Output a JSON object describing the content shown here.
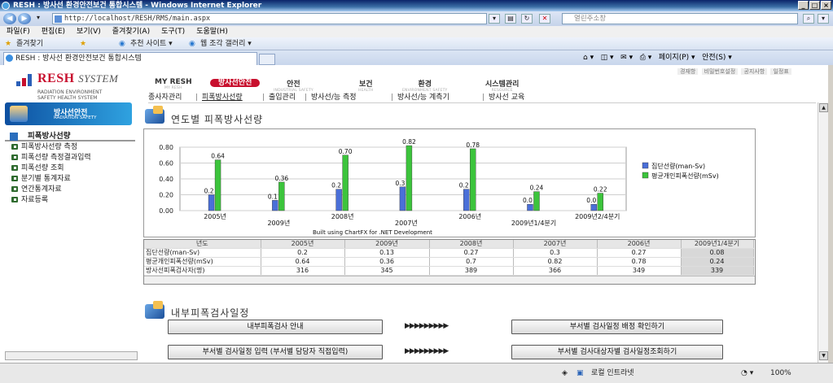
{
  "window": {
    "title": "RESH : 방사선 환경안전보건 통합시스템 - Windows Internet Explorer"
  },
  "browser": {
    "address": "http://localhost/RESH/RMS/main.aspx",
    "search_placeholder": "열린주소창",
    "menu": [
      "파일(F)",
      "편집(E)",
      "보기(V)",
      "즐겨찾기(A)",
      "도구(T)",
      "도움말(H)"
    ],
    "favorites_label": "즐겨찾기",
    "fav_suggest": "추천 사이트 ▾",
    "fav_gallery": "웹 조각 갤러리 ▾",
    "tab_title": "RESH : 방사선 환경안전보건 통합시스템",
    "page_menu": "페이지(P) ▾",
    "safety_menu": "안전(S) ▾"
  },
  "logo": {
    "brand": "RESH",
    "system": "SYSTEM",
    "sub1": "RADIATION ENVIRONMENT",
    "sub2": "SAFETY HEALTH SYSTEM"
  },
  "side_banner": {
    "title": "방사선안전",
    "sub": "RADIATION SAFETY"
  },
  "sidebar": {
    "heading": "피폭방사선량",
    "items": [
      "피폭방사선량 측정",
      "피폭선량 측정결과입력",
      "피폭선량 조회",
      "분기별 통계자료",
      "연간통계자료",
      "자료등록"
    ]
  },
  "util_links": [
    "경재항",
    "비밀번호설정",
    "공지사항",
    "일정표"
  ],
  "gnav": [
    {
      "label": "MY RESH",
      "sub": "MY RESH"
    },
    {
      "label": "방사선안전",
      "sub": ""
    },
    {
      "label": "안전",
      "sub": "INDUSTRIAL SAFETY"
    },
    {
      "label": "보건",
      "sub": "HEALTH"
    },
    {
      "label": "환경",
      "sub": "ENVIRONMENT SAFETY"
    },
    {
      "label": "시스템관리",
      "sub": "RESOURCE"
    }
  ],
  "subnav": [
    "종사자관리",
    "피폭방사선량",
    "출입관리",
    "방사선/능 측정",
    "방사선/능 계측기",
    "방사선 교육"
  ],
  "section1_title": "연도별 피폭방사선량",
  "section2_title": "내부피폭검사일정",
  "chart_data": {
    "type": "bar",
    "categories": [
      "2005년",
      "2009년",
      "2008년",
      "2007년",
      "2006년",
      "2009년1/4분기",
      "2009년2/4분기"
    ],
    "series": [
      {
        "name": "집단선량(man-Sv)",
        "color": "#4a6fd8",
        "values": [
          0.2,
          0.13,
          0.27,
          0.3,
          0.27,
          0.08,
          0.08
        ],
        "labels": [
          "0.2",
          "0.1",
          "0.2",
          "0.3",
          "0.2",
          "0.0",
          "0.0"
        ]
      },
      {
        "name": "평균개인피폭선량(mSv)",
        "color": "#3cc43c",
        "values": [
          0.64,
          0.36,
          0.7,
          0.82,
          0.78,
          0.24,
          0.22
        ],
        "labels": [
          "0.64",
          "0.36",
          "0.70",
          "0.82",
          "0.78",
          "0.24",
          "0.22"
        ]
      }
    ],
    "yticks": [
      "0.00",
      "0.20",
      "0.40",
      "0.60",
      "0.80"
    ],
    "ylim": [
      0,
      0.8
    ],
    "grid": true,
    "legend": "right",
    "footer": "Built using ChartFX for .NET Development"
  },
  "table": {
    "columns": [
      "년도",
      "2005년",
      "2009년",
      "2008년",
      "2007년",
      "2006년",
      "2009년1/4분기"
    ],
    "rows": [
      [
        "집단선량(man-Sv)",
        "0.2",
        "0.13",
        "0.27",
        "0.3",
        "0.27",
        "0.08"
      ],
      [
        "평균개인피폭선량(mSv)",
        "0.64",
        "0.36",
        "0.7",
        "0.82",
        "0.78",
        "0.24"
      ],
      [
        "방사선피폭검사자(명)",
        "316",
        "345",
        "389",
        "366",
        "349",
        "339"
      ]
    ]
  },
  "schedule": {
    "btn1": "내부피폭검사 안내",
    "btn2": "부서별 검사일정 배정 확인하기",
    "btn3": "부서별 검사일정 입력 (부서별 담당자 직접입력)",
    "btn4": "부서별 검사대상자별 검사일정조회하기",
    "arrows": "▶▶▶▶▶▶▶▶▶"
  },
  "status": {
    "zone": "로컬 인트라넷",
    "zoom": "100%"
  }
}
